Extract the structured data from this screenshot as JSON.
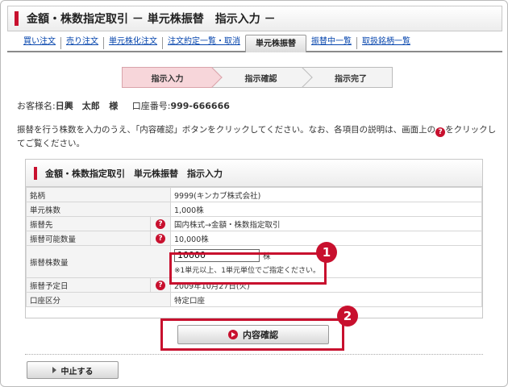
{
  "page": {
    "title": "金額・株数指定取引 － 単元株振替　指示入力 －"
  },
  "tabs": [
    {
      "label": "買い注文"
    },
    {
      "label": "売り注文"
    },
    {
      "label": "単元株化注文"
    },
    {
      "label": "注文約定一覧・取消"
    },
    {
      "label": "単元株振替"
    },
    {
      "label": "振替中一覧"
    },
    {
      "label": "取扱銘柄一覧"
    }
  ],
  "steps": [
    {
      "label": "指示入力"
    },
    {
      "label": "指示確認"
    },
    {
      "label": "指示完了"
    }
  ],
  "customer": {
    "name_label": "お客様名:",
    "name": "日興　太郎",
    "honorific": "様",
    "account_label": "口座番号:",
    "account": "999-666666"
  },
  "instructions": {
    "part1": "振替を行う株数を入力のうえ、「内容確認」ボタンをクリックしてください。なお、各項目の説明は、画面上の",
    "part2": "をクリックしてご覧ください。"
  },
  "panel": {
    "title": "金額・株数指定取引　単元株振替　指示入力"
  },
  "form": {
    "rows": [
      {
        "label": "銘柄",
        "value": "9999(キンカブ株式会社)"
      },
      {
        "label": "単元株数",
        "value": "1,000株"
      },
      {
        "label": "振替先",
        "value": "国内株式→金額・株数指定取引"
      },
      {
        "label": "振替可能数量",
        "value": "10,000株"
      },
      {
        "label": "振替株数量"
      },
      {
        "label": "振替予定日",
        "value": "2009年10月27日(火)"
      },
      {
        "label": "口座区分",
        "value": "特定口座"
      }
    ],
    "quantity_value": "10000",
    "quantity_unit": "株",
    "quantity_note": "※1単元以上、1単元単位でご指定ください。"
  },
  "help_icon_glyph": "?",
  "badges": {
    "one": "1",
    "two": "2"
  },
  "buttons": {
    "confirm": "内容確認",
    "stop": "中止する"
  },
  "colors": {
    "accent": "#c8102e",
    "link": "#0645ad",
    "current_step": "#f7d6da"
  }
}
